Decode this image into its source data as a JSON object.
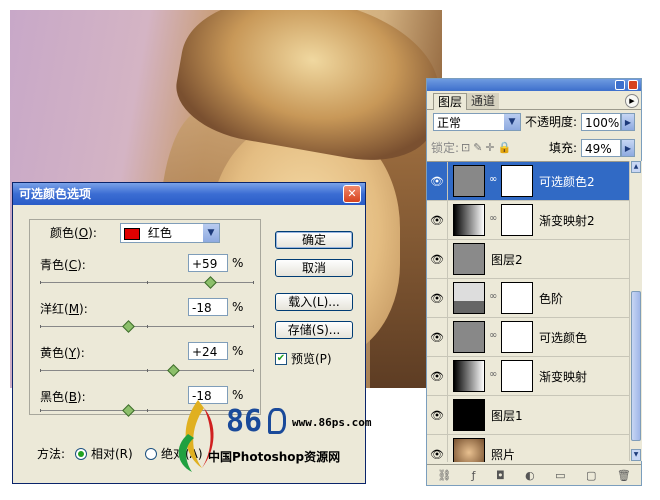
{
  "dialog": {
    "title": "可选颜色选项",
    "colors_label": "颜色(",
    "colors_key": "O",
    "colors_value": "红色",
    "swatch_color": "#e00000",
    "sliders": [
      {
        "label": "青色(",
        "key": "C",
        "value": "+59",
        "unit": "%",
        "level": 0.795
      },
      {
        "label": "洋红(",
        "key": "M",
        "value": "-18",
        "unit": "%",
        "level": 0.41
      },
      {
        "label": "黄色(",
        "key": "Y",
        "value": "+24",
        "unit": "%",
        "level": 0.62
      },
      {
        "label": "黑色(",
        "key": "B",
        "value": "-18",
        "unit": "%",
        "level": 0.41
      }
    ],
    "ok_label": "确定",
    "cancel_label": "取消",
    "load_label": "载入(L)...",
    "save_label": "存储(S)...",
    "preview_label": "预览(P)",
    "preview_checked": true,
    "method_label": "方法:",
    "method_relative": "相对(R)",
    "method_absolute": "绝对(A)",
    "method_selected": "relative"
  },
  "layers_panel": {
    "tab_layers": "图层",
    "tab_channels": "通道",
    "blend_mode": "正常",
    "opacity_label": "不透明度:",
    "opacity_value": "100%",
    "lock_label": "锁定:",
    "fill_label": "填充:",
    "fill_value": "49%",
    "layers": [
      {
        "name": "可选颜色2",
        "kind": "selective-color",
        "selected": true
      },
      {
        "name": "渐变映射2",
        "kind": "gradient-map",
        "selected": false
      },
      {
        "name": "图层2",
        "kind": "gray-fill",
        "selected": false
      },
      {
        "name": "色阶",
        "kind": "levels",
        "selected": false
      },
      {
        "name": "可选颜色",
        "kind": "selective-color",
        "selected": false
      },
      {
        "name": "渐变映射",
        "kind": "gradient-map",
        "selected": false
      },
      {
        "name": "图层1",
        "kind": "black-fill",
        "selected": false
      },
      {
        "name": "照片",
        "kind": "photo",
        "selected": false
      }
    ]
  },
  "watermark": {
    "logo_text": "86",
    "url": "www.86ps.com",
    "tagline": "中国Photoshop资源网"
  }
}
